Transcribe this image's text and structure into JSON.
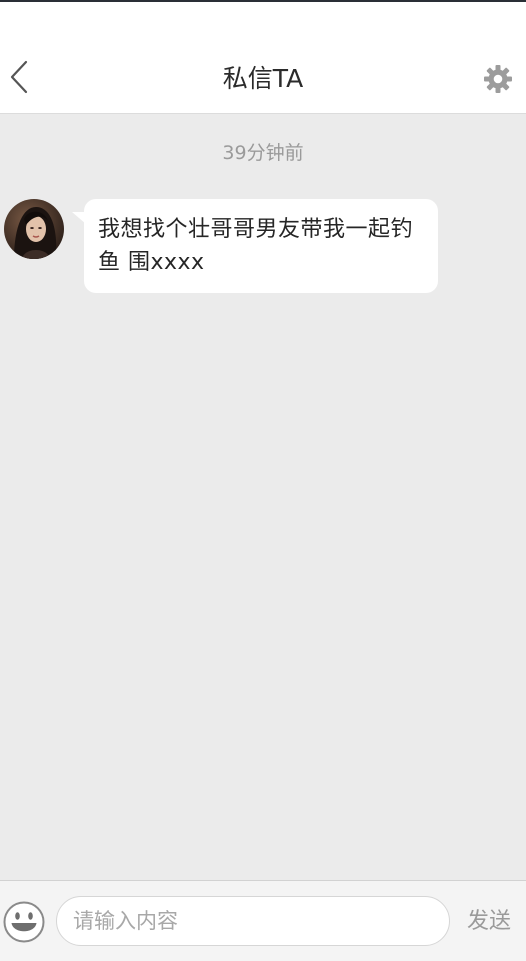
{
  "header": {
    "title": "私信TA",
    "back_icon": "chevron-left-icon",
    "settings_icon": "gear-icon"
  },
  "chat": {
    "timestamp": "39分钟前",
    "messages": [
      {
        "sender": "other",
        "avatar_icon": "avatar-photo",
        "text": "我想找个壮哥哥男友带我一起钓鱼 围xxxx"
      }
    ]
  },
  "composer": {
    "emoji_icon": "smiley-icon",
    "placeholder": "请输入内容",
    "value": "",
    "send_label": "发送"
  },
  "colors": {
    "chat_background": "#ebebeb",
    "header_background": "#ffffff",
    "bubble_background": "#ffffff",
    "muted_text": "#9a9a9a"
  }
}
